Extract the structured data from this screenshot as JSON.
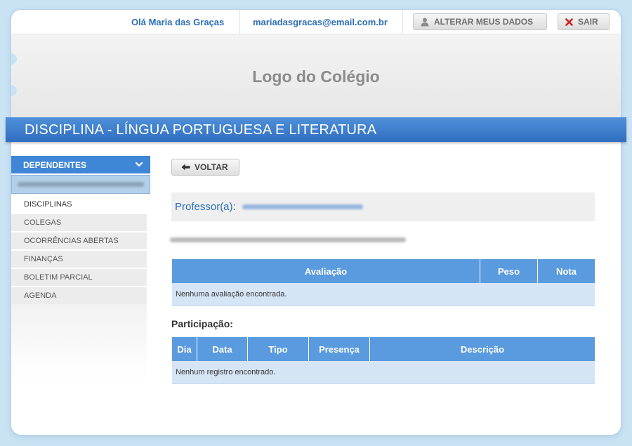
{
  "header": {
    "greeting": "Olá Maria das Graças",
    "email": "mariadasgracas@email.com.br",
    "alterar_label": "ALTERAR MEUS DADOS",
    "sair_label": "SAIR"
  },
  "logo": {
    "text": "Logo do Colégio"
  },
  "banner": {
    "title": "DISCIPLINA - LÍNGUA PORTUGUESA E LITERATURA"
  },
  "sidebar": {
    "header_label": "DEPENDENTES",
    "items": [
      {
        "label": "DISCIPLINAS"
      },
      {
        "label": "COLEGAS"
      },
      {
        "label": "OCORRÊNCIAS ABERTAS"
      },
      {
        "label": "FINANÇAS"
      },
      {
        "label": "BOLETIM PARCIAL"
      },
      {
        "label": "AGENDA"
      }
    ]
  },
  "main": {
    "voltar_label": "VOLTAR",
    "professor_label": "Professor(a):",
    "avaliacoes": {
      "columns": [
        "Avaliação",
        "Peso",
        "Nota"
      ],
      "empty_text": "Nenhuma avaliação encontrada."
    },
    "participacao": {
      "title": "Participação:",
      "columns": [
        "Dia",
        "Data",
        "Tipo",
        "Presença",
        "Descrição"
      ],
      "empty_text": "Nenhum registro encontrado."
    }
  },
  "colors": {
    "background": "#c9e3f4",
    "banner": "#3a7ccd",
    "link_text": "#2b6fb6",
    "table_header": "#5a9ade",
    "table_row": "#d6e5f6"
  }
}
